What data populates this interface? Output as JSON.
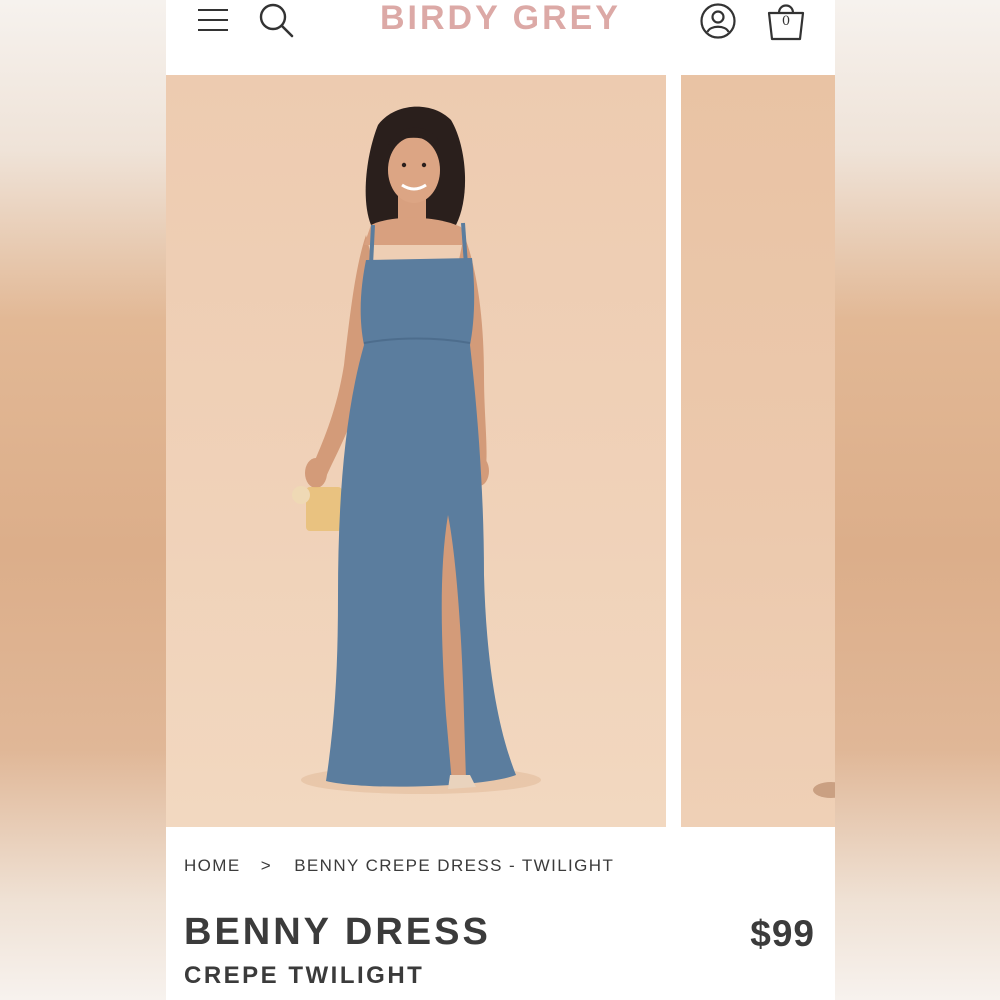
{
  "header": {
    "logo": "BIRDY GREY",
    "cart_count": "0",
    "icons": [
      "menu-icon",
      "search-icon",
      "account-icon",
      "shopping-bag-icon"
    ]
  },
  "breadcrumb": {
    "home": "HOME",
    "separator": ">",
    "current": "BENNY CREPE DRESS - TWILIGHT"
  },
  "product": {
    "title": "BENNY DRESS",
    "subtitle": "CREPE TWILIGHT",
    "price": "$99"
  },
  "colors": {
    "logo": "#dca9a6",
    "text": "#3b3b3b",
    "photo_background": "#eccaae",
    "dress_twilight": "#5b7d9e"
  }
}
